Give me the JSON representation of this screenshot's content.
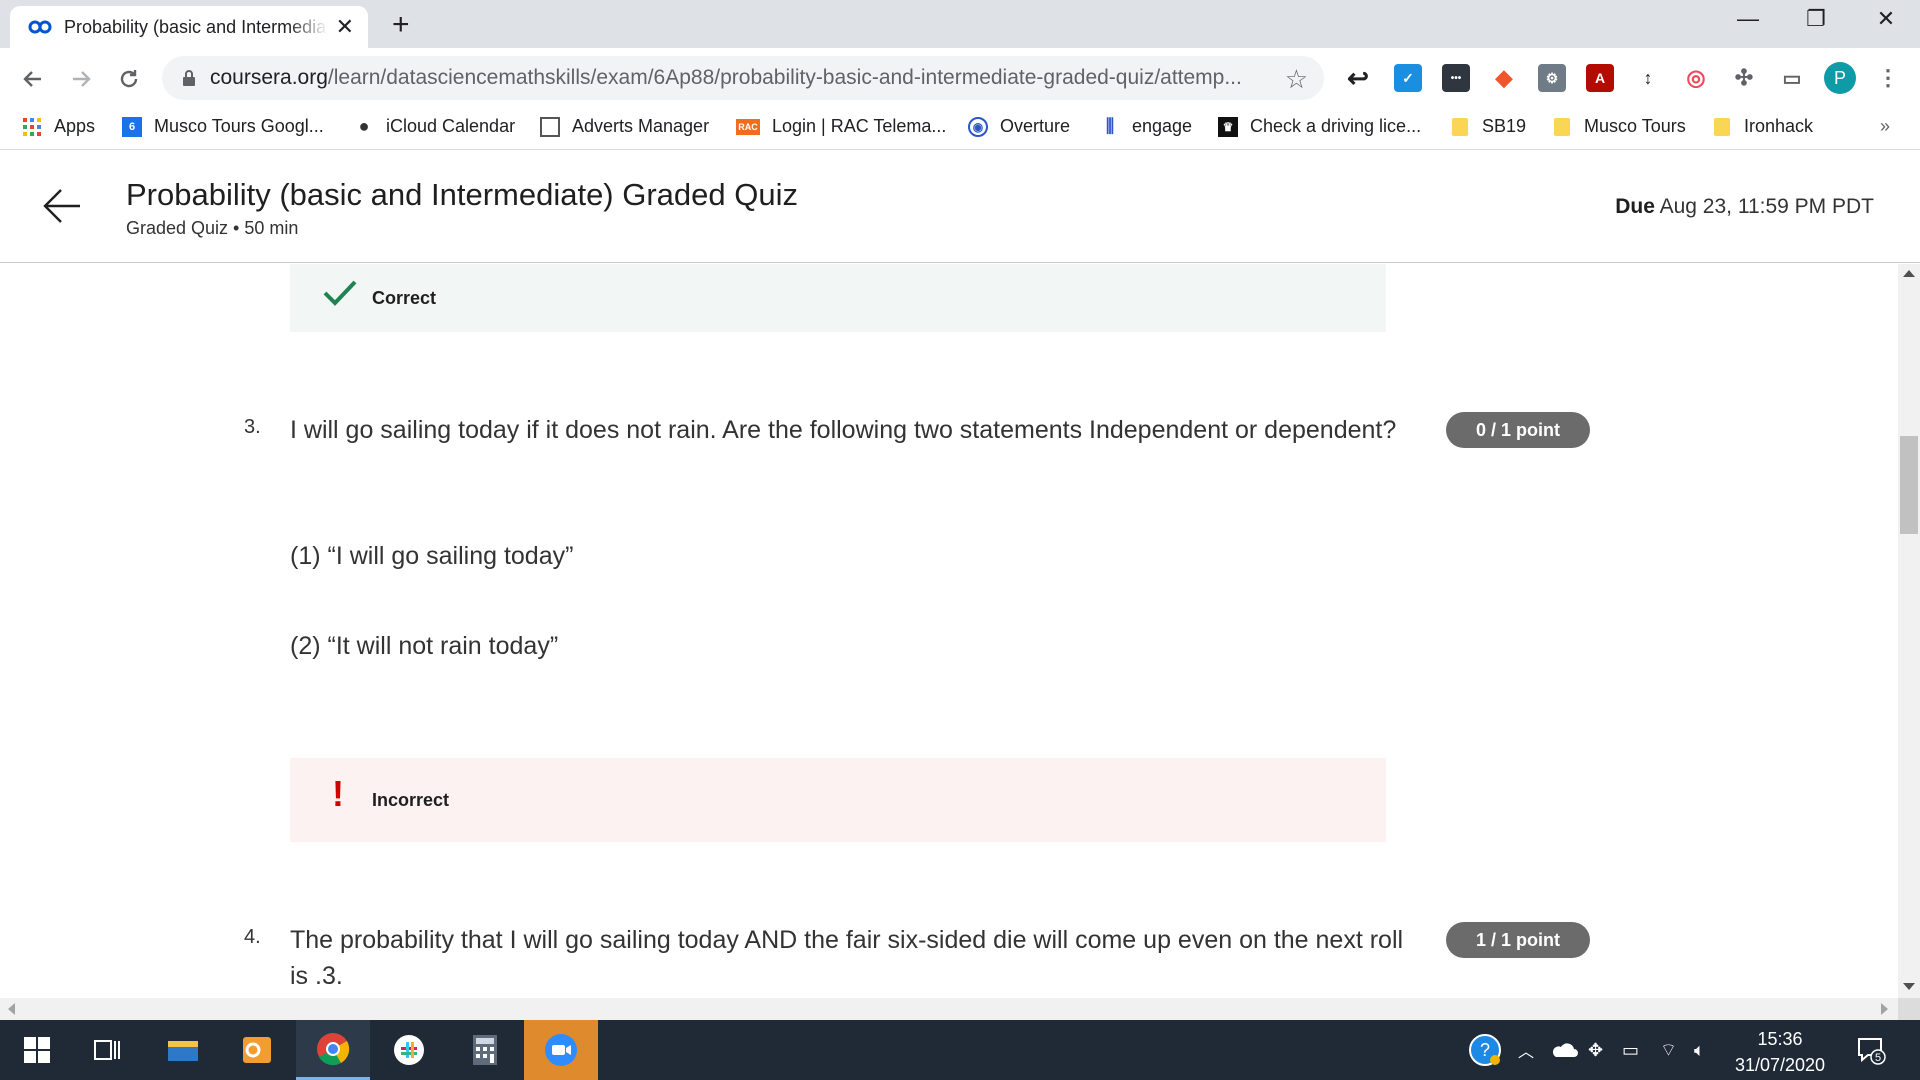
{
  "browser": {
    "tab_title": "Probability (basic and Intermediate) Graded Quiz",
    "url_host": "coursera.org",
    "url_path": "/learn/datasciencemathskills/exam/6Ap88/probability-basic-and-intermediate-graded-quiz/attemp...",
    "profile_initial": "P"
  },
  "bookmarks": [
    {
      "label": "Apps"
    },
    {
      "label": "Musco Tours Googl..."
    },
    {
      "label": "iCloud Calendar"
    },
    {
      "label": "Adverts Manager"
    },
    {
      "label": "Login | RAC Telema..."
    },
    {
      "label": "Overture"
    },
    {
      "label": "engage"
    },
    {
      "label": "Check a driving lice..."
    },
    {
      "label": "SB19"
    },
    {
      "label": "Musco Tours"
    },
    {
      "label": "Ironhack"
    }
  ],
  "bookmark_badges": {
    "calendar_day": "6",
    "rac": "RAC"
  },
  "header": {
    "title": "Probability (basic and Intermediate) Graded Quiz",
    "subtitle": "Graded Quiz • 50 min",
    "due_label": "Due",
    "due_value": "Aug 23, 11:59 PM PDT"
  },
  "feedback_prev": {
    "label": "Correct"
  },
  "q3": {
    "number": "3.",
    "text": "I will go sailing today if it does not rain. Are the following two statements Independent or dependent?",
    "statement1": "(1) “I will go sailing today”",
    "statement2": "(2) “It will not rain today”",
    "points": "0 / 1 point",
    "feedback": "Incorrect"
  },
  "q4": {
    "number": "4.",
    "text": "The probability that I will go sailing today AND the fair six-sided die will come up even on the next roll is .3.",
    "points": "1 / 1 point"
  },
  "taskbar": {
    "time": "15:36",
    "date": "31/07/2020",
    "notification_count": "5"
  },
  "colors": {
    "correct_bg": "#f2f7f5",
    "incorrect_bg": "#fcf2f2",
    "check_green": "#1f8354",
    "incorrect_red": "#d30000",
    "points_pill": "#6b6b6b"
  }
}
